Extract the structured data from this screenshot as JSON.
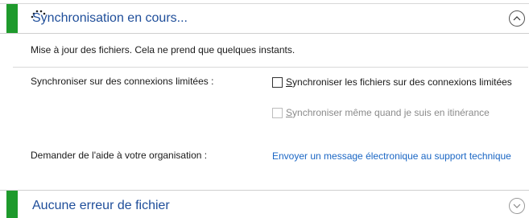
{
  "sync_section": {
    "title": "Synchronisation en cours...",
    "info": "Mise à jour des fichiers. Cela ne prend que quelques instants."
  },
  "metered": {
    "label": "Synchroniser sur des connexions limitées :",
    "option1": "Synchroniser les fichiers sur des connexions limitées",
    "option2": "Synchroniser même quand je suis en itinérance"
  },
  "help": {
    "label": "Demander de l'aide à votre organisation :",
    "link": "Envoyer un message électronique au support technique"
  },
  "errors_section": {
    "title": "Aucune erreur de fichier"
  },
  "colors": {
    "accent_green": "#1e9a2c",
    "title_blue": "#1f4e9a",
    "link_blue": "#1a66c4"
  },
  "icons": {
    "spinner": "spinner-icon",
    "collapse": "chevron-up-icon",
    "expand": "chevron-down-icon"
  }
}
